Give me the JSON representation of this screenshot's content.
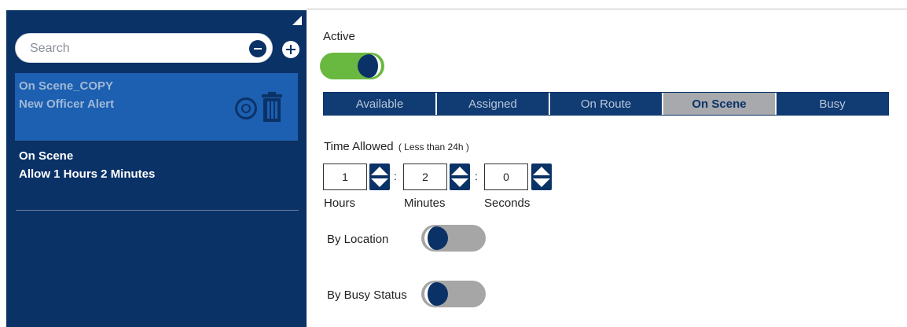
{
  "sidebar": {
    "search_placeholder": "Search",
    "items": [
      {
        "line1": "On Scene_COPY",
        "line2": "New Officer Alert",
        "selected": true
      },
      {
        "line1": "On Scene",
        "line2": "Allow 1 Hours 2 Minutes",
        "selected": false
      }
    ]
  },
  "form": {
    "active_label": "Active",
    "active_on": true,
    "status_tabs": [
      "Available",
      "Assigned",
      "On Route",
      "On Scene",
      "Busy"
    ],
    "selected_status": "On Scene",
    "time_allowed_label": "Time Allowed",
    "time_allowed_hint": "( Less than 24h )",
    "hours_value": "1",
    "minutes_value": "2",
    "seconds_value": "0",
    "separator": ":",
    "hours_label": "Hours",
    "minutes_label": "Minutes",
    "seconds_label": "Seconds",
    "by_location_label": "By Location",
    "by_location_on": false,
    "by_busy_status_label": "By Busy Status",
    "by_busy_status_on": false
  },
  "colors": {
    "sidebar_bg": "#0b3267",
    "selected_item_bg": "#1d5fb0",
    "toggle_on": "#69b83f",
    "toggle_off": "#a6a6a6",
    "tab_active": "#a7a9ad"
  },
  "icons": [
    "collapse-corner-icon",
    "clear-search-icon",
    "add-icon",
    "status-badge-icon",
    "trash-icon",
    "chevron-up-icon",
    "chevron-down-icon"
  ]
}
